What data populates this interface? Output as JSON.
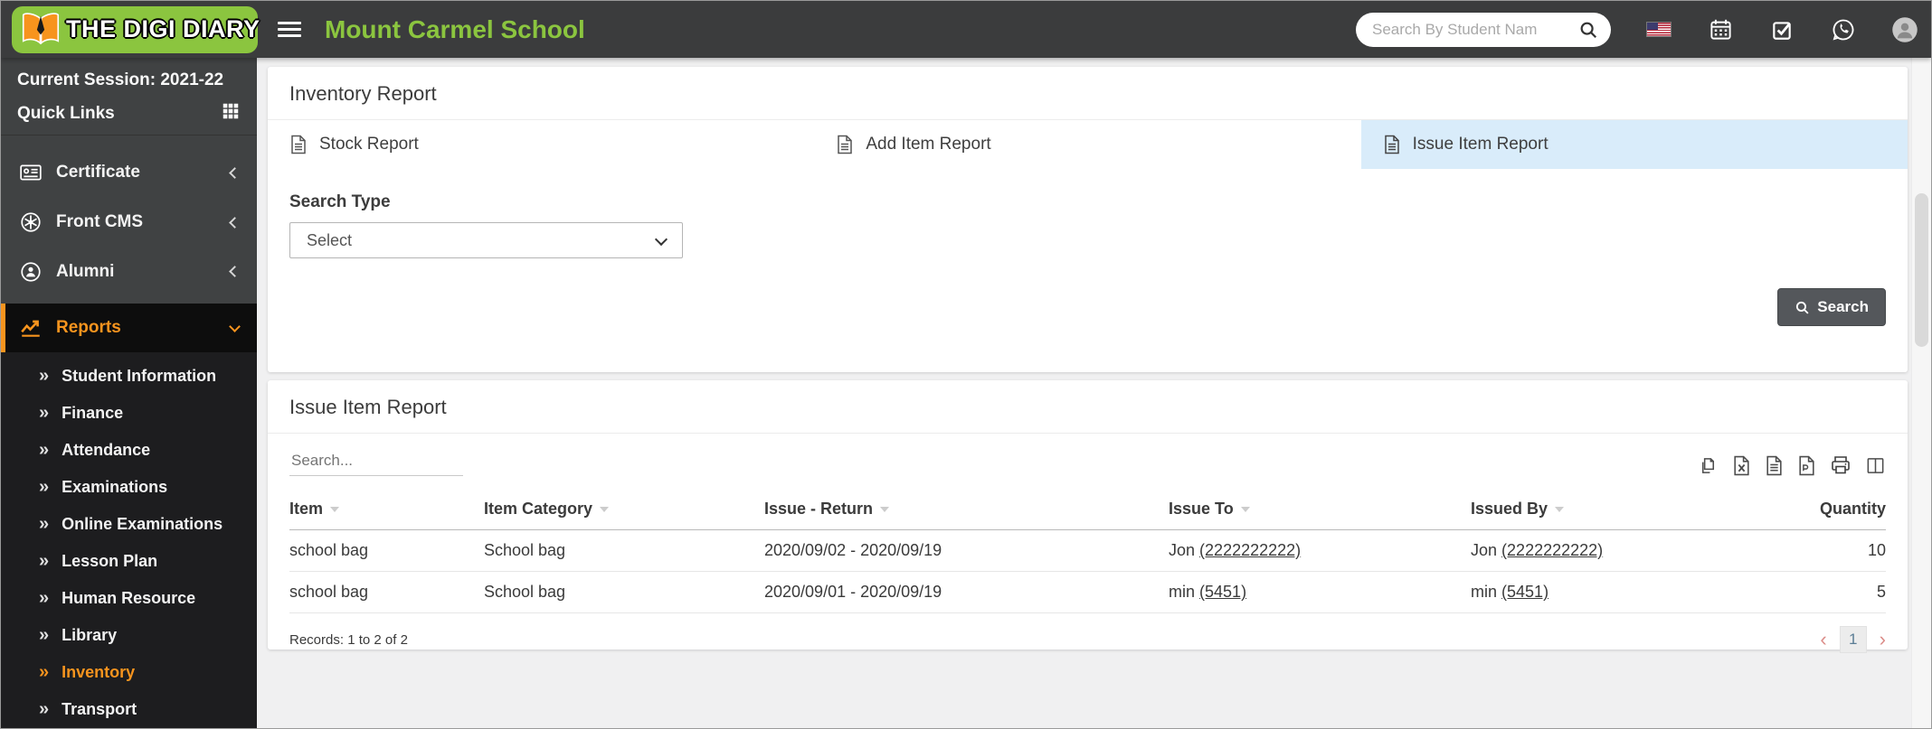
{
  "header": {
    "logo_text": "THE DIGI DIARY",
    "school_name": "Mount Carmel School",
    "search_placeholder": "Search By Student Nam"
  },
  "sidebar": {
    "session_label": "Current Session: 2021-22",
    "quick_links_label": "Quick Links",
    "menu": [
      {
        "label": "Certificate"
      },
      {
        "label": "Front CMS"
      },
      {
        "label": "Alumni"
      },
      {
        "label": "Reports"
      }
    ],
    "submenu": [
      "Student Information",
      "Finance",
      "Attendance",
      "Examinations",
      "Online Examinations",
      "Lesson Plan",
      "Human Resource",
      "Library",
      "Inventory",
      "Transport"
    ],
    "active_menu": "Reports",
    "active_submenu": "Inventory"
  },
  "inventory_report": {
    "title": "Inventory Report",
    "tabs": [
      {
        "label": "Stock Report"
      },
      {
        "label": "Add Item Report"
      },
      {
        "label": "Issue Item Report"
      }
    ],
    "active_tab": "Issue Item Report",
    "search_type_label": "Search Type",
    "search_type_value": "Select",
    "search_button_label": "Search"
  },
  "issue_report": {
    "title": "Issue Item Report",
    "search_placeholder": "Search...",
    "export_icons": [
      "copy",
      "excel",
      "csv",
      "pdf",
      "print",
      "columns"
    ],
    "table": {
      "columns": [
        "Item",
        "Item Category",
        "Issue - Return",
        "Issue To",
        "Issued By",
        "Quantity"
      ],
      "rows": [
        {
          "item": "school bag",
          "category": "School bag",
          "issue_return": "2020/09/02 - 2020/09/19",
          "issue_to_name": "Jon",
          "issue_to_phone": "(2222222222)",
          "issued_by_name": "Jon",
          "issued_by_phone": "(2222222222)",
          "quantity": "10"
        },
        {
          "item": "school bag",
          "category": "School bag",
          "issue_return": "2020/09/01 - 2020/09/19",
          "issue_to_name": "min",
          "issue_to_phone": "(5451)",
          "issued_by_name": "min",
          "issued_by_phone": "(5451)",
          "quantity": "5"
        }
      ]
    },
    "records_text": "Records: 1 to 2 of 2",
    "pagination": {
      "prev": "‹",
      "page": "1",
      "next": "›"
    }
  },
  "colors": {
    "accent_orange": "#f7941e",
    "brand_green": "#8bc53f",
    "active_tab_blue": "#d9ecfa",
    "header_bg": "#3b3c3d",
    "sidebar_bg": "#404243",
    "submenu_bg": "#1d1d1f"
  }
}
